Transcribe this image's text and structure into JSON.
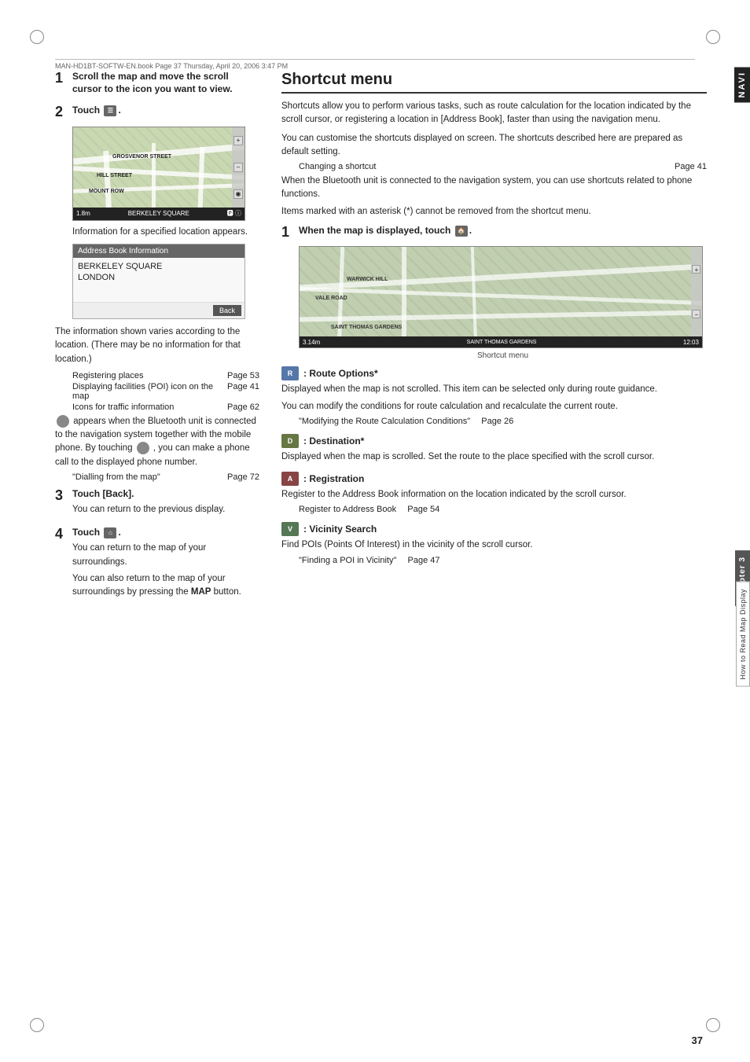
{
  "page": {
    "number": "37",
    "header_text": "MAN-HD1BT-SOFTW-EN.book  Page 37  Thursday, April 20, 2006  3:47 PM"
  },
  "navi_tab": "NAVI",
  "chapter_tab": "Chapter 3",
  "chapter_label": "How to Read Map Display",
  "left_column": {
    "step1": {
      "num": "1",
      "title": "Scroll the map and move the scroll cursor to the icon you want to view."
    },
    "step2": {
      "num": "2",
      "label": "Touch",
      "icon_hint": "menu icon"
    },
    "step2_caption": "Information for a specified location appears.",
    "addr_box": {
      "header": "Address Book Information",
      "lines": [
        "BERKELEY SQUARE",
        "LONDON"
      ],
      "back_btn": "Back"
    },
    "info_text": "The information shown varies according to the location. (There may be no information for that location.)",
    "refs": [
      {
        "text": "Registering places",
        "page": "Page 53"
      },
      {
        "text": "Displaying facilities (POI) icon on the map",
        "page": "Page 41"
      },
      {
        "text": "Icons for traffic information",
        "page": "Page 62"
      }
    ],
    "bluetooth_text1": "appears when the Bluetooth unit is connected to the navigation system together with the mobile phone. By touching",
    "bluetooth_text2": ", you can make a phone call to the displayed phone number.",
    "dialling_ref": {
      "text": "\"Dialling from the map\"",
      "page": "Page 72"
    },
    "step3": {
      "num": "3",
      "label": "Touch [Back].",
      "desc": "You can return to the previous display."
    },
    "step4": {
      "num": "4",
      "label": "Touch",
      "icon_hint": "home icon",
      "desc1": "You can return to the map of your surroundings.",
      "desc2": "You can also return to the map of your surroundings by pressing the",
      "desc2_bold": "MAP",
      "desc2_end": "button."
    }
  },
  "right_column": {
    "section_title": "Shortcut menu",
    "intro": "Shortcuts allow you to perform various tasks, such as route calculation for the location indicated by the scroll cursor, or registering a location in [Address Book], faster than using the navigation menu.",
    "customise_text": "You can customise the shortcuts displayed on screen. The shortcuts described here are prepared as default setting.",
    "changing_ref": {
      "text": "Changing a shortcut",
      "page": "Page 41"
    },
    "bluetooth_text": "When the Bluetooth unit is connected to the navigation system, you can use shortcuts related to phone functions.",
    "asterisk_text": "Items marked with an asterisk (*) cannot be removed from the shortcut menu.",
    "step1": {
      "num": "1",
      "label": "When the map is displayed, touch",
      "icon_hint": "shortcut icon"
    },
    "map_caption": "Shortcut menu",
    "shortcuts": [
      {
        "icon_type": "route",
        "icon_label": "R",
        "title": ": Route Options*",
        "desc": "Displayed when the map is not scrolled. This item can be selected only during route guidance.",
        "extra": "You can modify the conditions for route calculation and recalculate the current route.",
        "ref_text": "\"Modifying the Route Calculation Conditions\"",
        "ref_page": "Page 26"
      },
      {
        "icon_type": "dest",
        "icon_label": "D",
        "title": ": Destination*",
        "desc": "Displayed when the map is scrolled. Set the route to the place specified with the scroll cursor."
      },
      {
        "icon_type": "reg",
        "icon_label": "A",
        "title": ": Registration",
        "desc": "Register to the Address Book information on the location indicated by the scroll cursor.",
        "ref_text": "Register to Address Book",
        "ref_page": "Page 54"
      },
      {
        "icon_type": "vic",
        "icon_label": "V",
        "title": ": Vicinity Search",
        "desc": "Find POIs (Points Of Interest) in the vicinity of the scroll cursor.",
        "ref_text": "\"Finding a POI in Vicinity\"",
        "ref_page": "Page 47"
      }
    ]
  }
}
